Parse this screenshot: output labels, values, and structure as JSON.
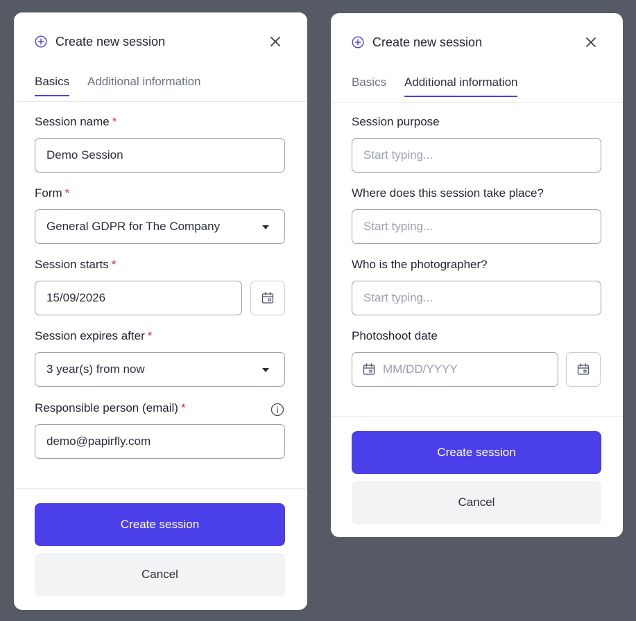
{
  "left_dialog": {
    "title": "Create new session",
    "icons": {
      "title_icon": "plus-circle-icon",
      "close_icon": "close-icon"
    },
    "tabs": [
      {
        "label": "Basics",
        "active": true
      },
      {
        "label": "Additional information",
        "active": false
      }
    ],
    "fields": {
      "session_name": {
        "label": "Session name",
        "required_mark": "*",
        "value": "Demo Session"
      },
      "form": {
        "label": "Form",
        "required_mark": "*",
        "value": "General GDPR for The Company"
      },
      "session_starts": {
        "label": "Session starts",
        "required_mark": "*",
        "value": "15/09/2026"
      },
      "session_expires": {
        "label": "Session expires after",
        "required_mark": "*",
        "value": "3 year(s) from now"
      },
      "responsible_person": {
        "label": "Responsible person (email)",
        "required_mark": "*",
        "value": "demo@papirfly.com"
      }
    },
    "primary_button": "Create session",
    "secondary_button": "Cancel"
  },
  "right_dialog": {
    "title": "Create new session",
    "icons": {
      "title_icon": "plus-circle-icon",
      "close_icon": "close-icon"
    },
    "tabs": [
      {
        "label": "Basics",
        "active": false
      },
      {
        "label": "Additional information",
        "active": true
      }
    ],
    "fields": {
      "session_purpose": {
        "label": "Session purpose",
        "placeholder": "Start typing..."
      },
      "location": {
        "label": "Where does this session take place?",
        "placeholder": "Start typing..."
      },
      "photographer": {
        "label": "Who is the photographer?",
        "placeholder": "Start typing..."
      },
      "photoshoot_date": {
        "label": "Photoshoot date",
        "placeholder": "MM/DD/YYYY"
      }
    },
    "primary_button": "Create session",
    "secondary_button": "Cancel"
  },
  "colors": {
    "backdrop": "#555a64",
    "accent": "#4a3fe8",
    "required": "#e03131",
    "secondary_button_bg": "#f2f3f5"
  }
}
